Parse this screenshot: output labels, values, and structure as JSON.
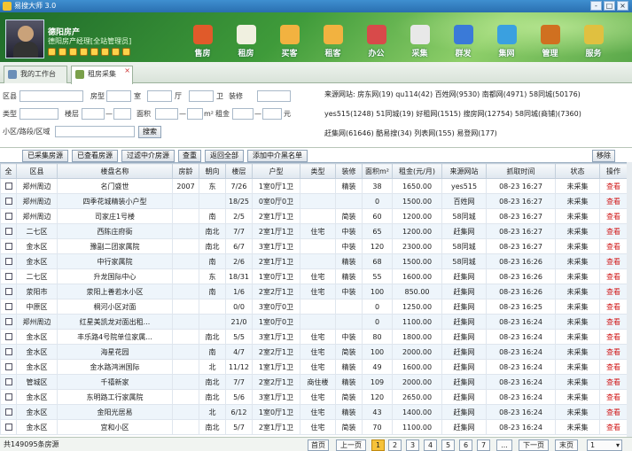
{
  "window": {
    "title": "易搜大师 3.0",
    "buttons": [
      "-",
      "□",
      "×"
    ]
  },
  "user": {
    "name": "德阳房产",
    "info": "德阳房产经理[全站管理员]"
  },
  "nav": [
    {
      "label": "售房",
      "icon": "house-sale-icon",
      "color": "#e05a2a"
    },
    {
      "label": "租房",
      "icon": "house-rent-icon",
      "color": "#f0f0e0"
    },
    {
      "label": "买客",
      "icon": "buyers-icon",
      "color": "#f2b240"
    },
    {
      "label": "租客",
      "icon": "tenants-icon",
      "color": "#f2b240"
    },
    {
      "label": "办公",
      "icon": "office-icon",
      "color": "#d84a4a"
    },
    {
      "label": "采集",
      "icon": "collect-icon",
      "color": "#e8e8e8"
    },
    {
      "label": "群发",
      "icon": "broadcast-icon",
      "color": "#3a7ad8"
    },
    {
      "label": "集网",
      "icon": "globe-icon",
      "color": "#3aa0e0"
    },
    {
      "label": "管理",
      "icon": "tools-icon",
      "color": "#d07020"
    },
    {
      "label": "服务",
      "icon": "service-badge-icon",
      "color": "#e0c040"
    }
  ],
  "tabs": [
    {
      "label": "我的工作台",
      "active": false
    },
    {
      "label": "租房采集",
      "active": true
    }
  ],
  "filters": {
    "district": "区县",
    "type": "房型",
    "room": "室",
    "hall": "厅",
    "bath": "卫",
    "decor": "装修",
    "kind": "类型",
    "floor": "楼层",
    "area": "面积",
    "area_unit": "m²",
    "rent": "租金",
    "rent_unit": "元",
    "community": "小区/路段/区域",
    "search": "搜索",
    "dash": "—"
  },
  "sites": {
    "label": "来源网站:",
    "line1": [
      "房东网(19)",
      "qu114(42)",
      "百姓网(9530)",
      "南都网(4971)",
      "58同城(50176)"
    ],
    "line2": [
      "yes515(1248)",
      "51同城(19)",
      "好租网(1515)",
      "搜房网(12754)",
      "58同城(商铺)(7360)"
    ],
    "line3": [
      "赶集网(61646)",
      "酷易搜(34)",
      "列表网(155)",
      "易登网(177)"
    ]
  },
  "toolbar": {
    "collected": "已采集房源",
    "viewed": "已查看房源",
    "filter_agent": "过滤中介房源",
    "recheck": "查重",
    "return_all": "返回全部",
    "add_agent": "添加中介黑名单",
    "remove": "移除"
  },
  "table": {
    "columns": [
      "全",
      "区县",
      "楼盘名称",
      "房龄",
      "朝向",
      "楼层",
      "户型",
      "类型",
      "装修",
      "面积m²",
      "租金(元/月)",
      "来源网站",
      "抓取时间",
      "状态",
      "操作"
    ],
    "rows": [
      [
        "郑州周边",
        "名门盛世",
        "2007",
        "东",
        "7/26",
        "1室0厅1卫",
        "",
        "精装",
        "38",
        "1650.00",
        "yes515",
        "08-23 16:27",
        "未采集",
        "查看"
      ],
      [
        "郑州周边",
        "四季花城精装小户型",
        "",
        "",
        "18/25",
        "0室0厅0卫",
        "",
        "",
        "0",
        "1500.00",
        "百姓网",
        "08-23 16:27",
        "未采集",
        "查看"
      ],
      [
        "郑州周边",
        "司家庄1号楼",
        "",
        "南",
        "2/5",
        "2室1厅1卫",
        "",
        "简装",
        "60",
        "1200.00",
        "58同城",
        "08-23 16:27",
        "未采集",
        "查看"
      ],
      [
        "二七区",
        "西陈庄府衙",
        "",
        "南北",
        "7/7",
        "2室1厅1卫",
        "住宅",
        "中装",
        "65",
        "1200.00",
        "赶集网",
        "08-23 16:27",
        "未采集",
        "查看"
      ],
      [
        "金水区",
        "豫副二团家属院",
        "",
        "南北",
        "6/7",
        "3室1厅1卫",
        "",
        "中装",
        "120",
        "2300.00",
        "58同城",
        "08-23 16:27",
        "未采集",
        "查看"
      ],
      [
        "金水区",
        "中行家属院",
        "",
        "南",
        "2/6",
        "2室1厅1卫",
        "",
        "精装",
        "68",
        "1500.00",
        "58同城",
        "08-23 16:26",
        "未采集",
        "查看"
      ],
      [
        "二七区",
        "升龙国际中心",
        "",
        "东",
        "18/31",
        "1室0厅1卫",
        "住宅",
        "精装",
        "55",
        "1600.00",
        "赶集网",
        "08-23 16:26",
        "未采集",
        "查看"
      ],
      [
        "荥阳市",
        "荥阳上善若水小区",
        "",
        "南",
        "1/6",
        "2室2厅1卫",
        "住宅",
        "中装",
        "100",
        "850.00",
        "赶集网",
        "08-23 16:26",
        "未采集",
        "查看"
      ],
      [
        "中原区",
        "桐河小区对面",
        "",
        "",
        "0/0",
        "3室0厅0卫",
        "",
        "",
        "0",
        "1250.00",
        "赶集网",
        "08-23 16:25",
        "未采集",
        "查看"
      ],
      [
        "郑州周边",
        "红星美凯龙对面出租...",
        "",
        "",
        "21/0",
        "1室0厅0卫",
        "",
        "",
        "0",
        "1100.00",
        "赶集网",
        "08-23 16:24",
        "未采集",
        "查看"
      ],
      [
        "金水区",
        "丰乐路4号院单位家属...",
        "",
        "南北",
        "5/5",
        "3室1厅1卫",
        "住宅",
        "中装",
        "80",
        "1800.00",
        "赶集网",
        "08-23 16:24",
        "未采集",
        "查看"
      ],
      [
        "金水区",
        "海星花园",
        "",
        "南",
        "4/7",
        "2室2厅1卫",
        "住宅",
        "简装",
        "100",
        "2000.00",
        "赶集网",
        "08-23 16:24",
        "未采集",
        "查看"
      ],
      [
        "金水区",
        "金水路鸿洲国际",
        "",
        "北",
        "11/12",
        "1室1厅1卫",
        "住宅",
        "精装",
        "49",
        "1600.00",
        "赶集网",
        "08-23 16:24",
        "未采集",
        "查看"
      ],
      [
        "管城区",
        "千禧新家",
        "",
        "南北",
        "7/7",
        "2室2厅1卫",
        "商住楼",
        "精装",
        "109",
        "2000.00",
        "赶集网",
        "08-23 16:24",
        "未采集",
        "查看"
      ],
      [
        "金水区",
        "东明路工行家属院",
        "",
        "南北",
        "5/6",
        "3室1厅1卫",
        "住宅",
        "简装",
        "120",
        "2650.00",
        "赶集网",
        "08-23 16:24",
        "未采集",
        "查看"
      ],
      [
        "金水区",
        "金阳光居易",
        "",
        "北",
        "6/12",
        "1室0厅1卫",
        "住宅",
        "精装",
        "43",
        "1400.00",
        "赶集网",
        "08-23 16:24",
        "未采集",
        "查看"
      ],
      [
        "金水区",
        "宜和小区",
        "",
        "南北",
        "5/7",
        "2室1厅1卫",
        "住宅",
        "简装",
        "70",
        "1100.00",
        "赶集网",
        "08-23 16:24",
        "未采集",
        "查看"
      ]
    ]
  },
  "status": {
    "count": "共149095条房源",
    "first": "首页",
    "prev": "上一页",
    "pages": [
      "1",
      "2",
      "3",
      "4",
      "5",
      "6",
      "7",
      "..."
    ],
    "next": "下一页",
    "last": "末页",
    "page_select": "1"
  }
}
